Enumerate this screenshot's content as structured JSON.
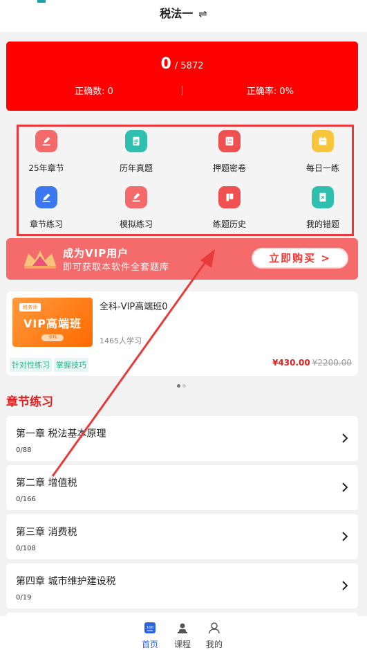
{
  "header": {
    "title": "税法一",
    "swap_symbol": "⇌"
  },
  "stats": {
    "answered": "0",
    "total": "/ 5872",
    "correct_label": "正确数: 0",
    "rate_label": "正确率: 0%"
  },
  "grid": {
    "items": [
      {
        "label": "25年章节",
        "icon": "pen-edit-icon",
        "color": "#f46a6a"
      },
      {
        "label": "历年真题",
        "icon": "document-icon",
        "color": "#2fbfae"
      },
      {
        "label": "押题密卷",
        "icon": "score-100-icon",
        "color": "#f05050"
      },
      {
        "label": "每日一练",
        "icon": "calendar-icon",
        "color": "#f9c53b"
      },
      {
        "label": "章节练习",
        "icon": "pencil-icon",
        "color": "#3b78f0"
      },
      {
        "label": "模拟练习",
        "icon": "pen-edit-icon",
        "color": "#f46a6a"
      },
      {
        "label": "练题历史",
        "icon": "book-history-icon",
        "color": "#f05050"
      },
      {
        "label": "我的错题",
        "icon": "error-book-icon",
        "color": "#2fbfae"
      }
    ]
  },
  "vip": {
    "title": "成为VIP用户",
    "subtitle": "即可获取本软件全套题库",
    "button": "立即购买 >"
  },
  "course": {
    "thumb_tag": "税务师",
    "thumb_title": "VIP高端班",
    "thumb_pill": "全科",
    "name": "全科-VIP高端班0",
    "learners": "1465人学习",
    "chips": [
      "针对性练习",
      "掌握技巧"
    ],
    "price": "¥430.00",
    "old_price": "¥2200.00"
  },
  "section": {
    "title": "章节练习"
  },
  "chapters": [
    {
      "name": "第一章 税法基本原理",
      "progress": "0/88"
    },
    {
      "name": "第二章 增值税",
      "progress": "0/166"
    },
    {
      "name": "第三章 消费税",
      "progress": "0/108"
    },
    {
      "name": "第四章 城市维护建设税",
      "progress": "0/19"
    }
  ],
  "tabs": [
    {
      "label": "首页",
      "icon": "home-100-icon",
      "active": true
    },
    {
      "label": "课程",
      "icon": "course-icon",
      "active": false
    },
    {
      "label": "我的",
      "icon": "user-icon",
      "active": false
    }
  ],
  "colors": {
    "accent_red": "#ff0000",
    "tab_active": "#2d62e0",
    "highlight_border": "#e8393b"
  }
}
